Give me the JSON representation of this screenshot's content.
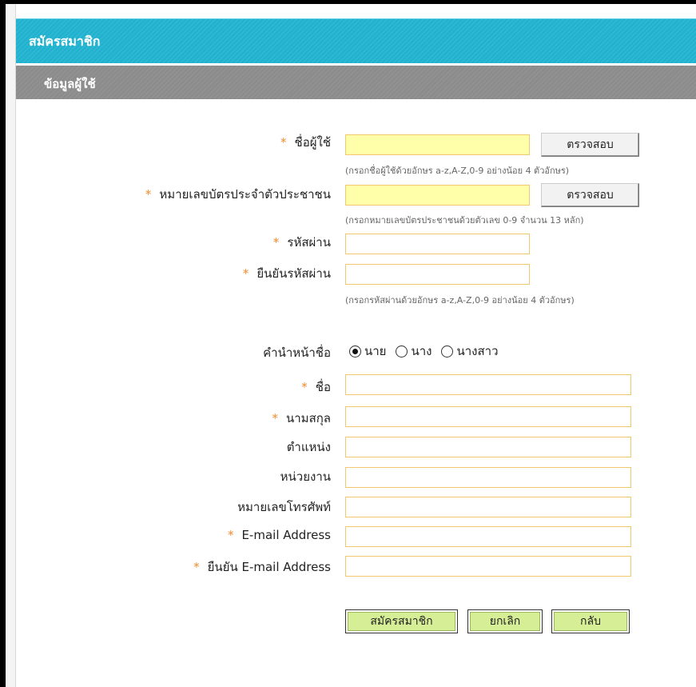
{
  "header": {
    "title": "สมัครสมาชิก",
    "section": "ข้อมูลผู้ใช้"
  },
  "required_mark": "*",
  "fields": {
    "username": {
      "label": "ชื่อผู้ใช้",
      "value": "",
      "required": true,
      "check_label": "ตรวจสอบ",
      "hint": "(กรอกชื่อผู้ใช้ด้วยอักษร a-z,A-Z,0-9 อย่างน้อย 4 ตัวอักษร)"
    },
    "id_number": {
      "label": "หมายเลขบัตรประจำตัวประชาชน",
      "value": "",
      "required": true,
      "check_label": "ตรวจสอบ",
      "hint": "(กรอกหมายเลขบัตรประชาชนด้วยตัวเลข 0-9 จำนวน 13 หลัก)"
    },
    "password": {
      "label": "รหัสผ่าน",
      "value": "",
      "required": true
    },
    "confirm_password": {
      "label": "ยืนยันรหัสผ่าน",
      "value": "",
      "required": true,
      "hint": "(กรอกรหัสผ่านด้วยอักษร a-z,A-Z,0-9 อย่างน้อย 4 ตัวอักษร)"
    },
    "title_prefix": {
      "label": "คำนำหน้าชื่อ",
      "options": [
        "นาย",
        "นาง",
        "นางสาว"
      ],
      "selected": "นาย"
    },
    "first_name": {
      "label": "ชื่อ",
      "value": "",
      "required": true
    },
    "last_name": {
      "label": "นามสกุล",
      "value": "",
      "required": true
    },
    "position": {
      "label": "ตำแหน่ง",
      "value": ""
    },
    "department": {
      "label": "หน่วยงาน",
      "value": ""
    },
    "phone": {
      "label": "หมายเลขโทรศัพท์",
      "value": ""
    },
    "email": {
      "label": "E-mail Address",
      "value": "",
      "required": true
    },
    "confirm_email": {
      "label": "ยืนยัน E-mail Address",
      "value": "",
      "required": true
    }
  },
  "actions": {
    "submit": "สมัครสมาชิก",
    "cancel": "ยกเลิก",
    "back": "กลับ"
  },
  "colors": {
    "title_bar": "#20b2cf",
    "section_bar": "#8c8c8c",
    "required": "#f08a2c",
    "input_border": "#f0c870",
    "highlight_input": "#ffffaa",
    "action_button": "#d6ee96"
  }
}
